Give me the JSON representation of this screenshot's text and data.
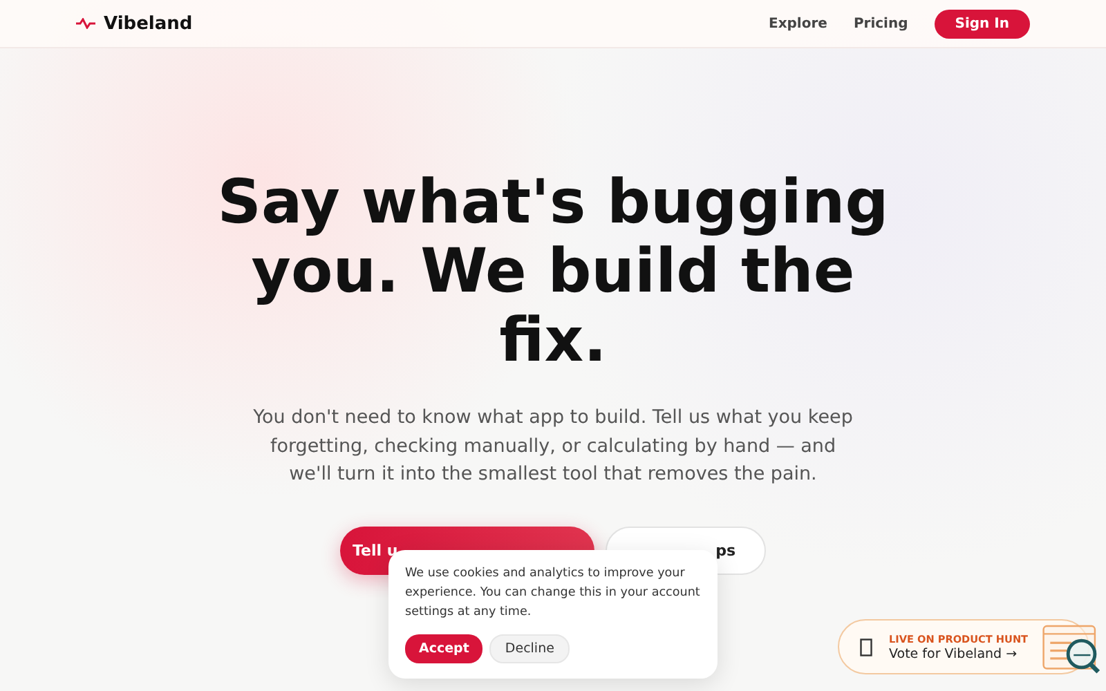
{
  "nav": {
    "brand": "Vibeland",
    "links": [
      "Explore",
      "Pricing"
    ],
    "sign_in": "Sign In"
  },
  "hero": {
    "headline": "Say what's bugging you. We build the fix.",
    "subtitle": "You don't need to know what app to build. Tell us what you keep forgetting, checking manually, or calculating by hand — and we'll turn it into the smallest tool that removes the pain.",
    "primary_button": "Tell u",
    "secondary_button": "ps"
  },
  "cookie_banner": {
    "message": "We use cookies and analytics to improve your experience. You can change this in your account settings at any time.",
    "accept": "Accept",
    "decline": "Decline"
  },
  "product_hunt": {
    "label": "LIVE ON PRODUCT HUNT",
    "cta": "Vote for Vibeland →"
  }
}
